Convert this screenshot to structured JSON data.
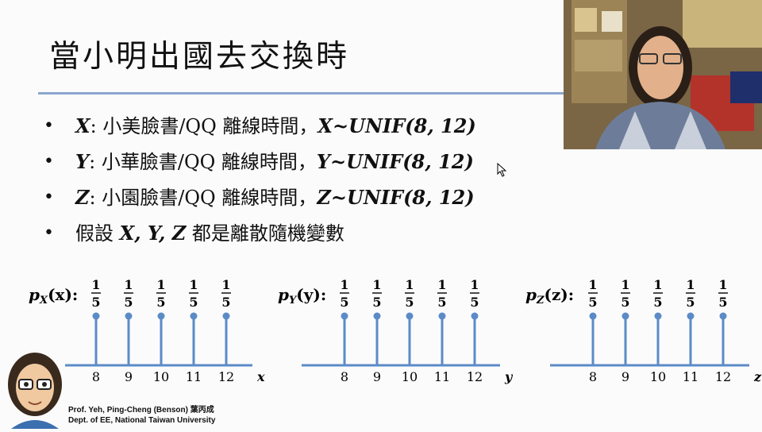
{
  "slide": {
    "title": "當小明出國去交換時",
    "bullets": [
      {
        "var": "X",
        "text": ": 小美臉書/QQ 離線時間，",
        "formula": "X~UNIF(8, 12)"
      },
      {
        "var": "Y",
        "text": ": 小華臉書/QQ 離線時間，",
        "formula": "Y~UNIF(8, 12)"
      },
      {
        "var": "Z",
        "text": ": 小園臉書/QQ 離線時間，",
        "formula": "Z~UNIF(8, 12)"
      },
      {
        "var": "",
        "text": "假設 ",
        "formula": "X, Y, Z",
        "suffix": " 都是離散隨機變數"
      }
    ],
    "bullet_glyph": "•"
  },
  "chart_data": [
    {
      "type": "bar",
      "label": "p_X(x):",
      "var": "X",
      "arg": "x",
      "axis": "x",
      "categories": [
        "8",
        "9",
        "10",
        "11",
        "12"
      ],
      "values": [
        0.2,
        0.2,
        0.2,
        0.2,
        0.2
      ],
      "value_labels": [
        "1/5",
        "1/5",
        "1/5",
        "1/5",
        "1/5"
      ]
    },
    {
      "type": "bar",
      "label": "p_Y(y):",
      "var": "Y",
      "arg": "y",
      "axis": "y",
      "categories": [
        "8",
        "9",
        "10",
        "11",
        "12"
      ],
      "values": [
        0.2,
        0.2,
        0.2,
        0.2,
        0.2
      ],
      "value_labels": [
        "1/5",
        "1/5",
        "1/5",
        "1/5",
        "1/5"
      ]
    },
    {
      "type": "bar",
      "label": "p_Z(z):",
      "var": "Z",
      "arg": "z",
      "axis": "z",
      "categories": [
        "8",
        "9",
        "10",
        "11",
        "12"
      ],
      "values": [
        0.2,
        0.2,
        0.2,
        0.2,
        0.2
      ],
      "value_labels": [
        "1/5",
        "1/5",
        "1/5",
        "1/5",
        "1/5"
      ]
    }
  ],
  "stem_color": "#5b8bc7",
  "footer": {
    "line1": "Prof. Yeh, Ping-Cheng (Benson) 葉丙成",
    "line2": "Dept. of EE,  National Taiwan University"
  },
  "icons": {
    "webcam": "presenter-video",
    "avatar": "cartoon-avatar",
    "cursor": "mouse-pointer-icon"
  }
}
